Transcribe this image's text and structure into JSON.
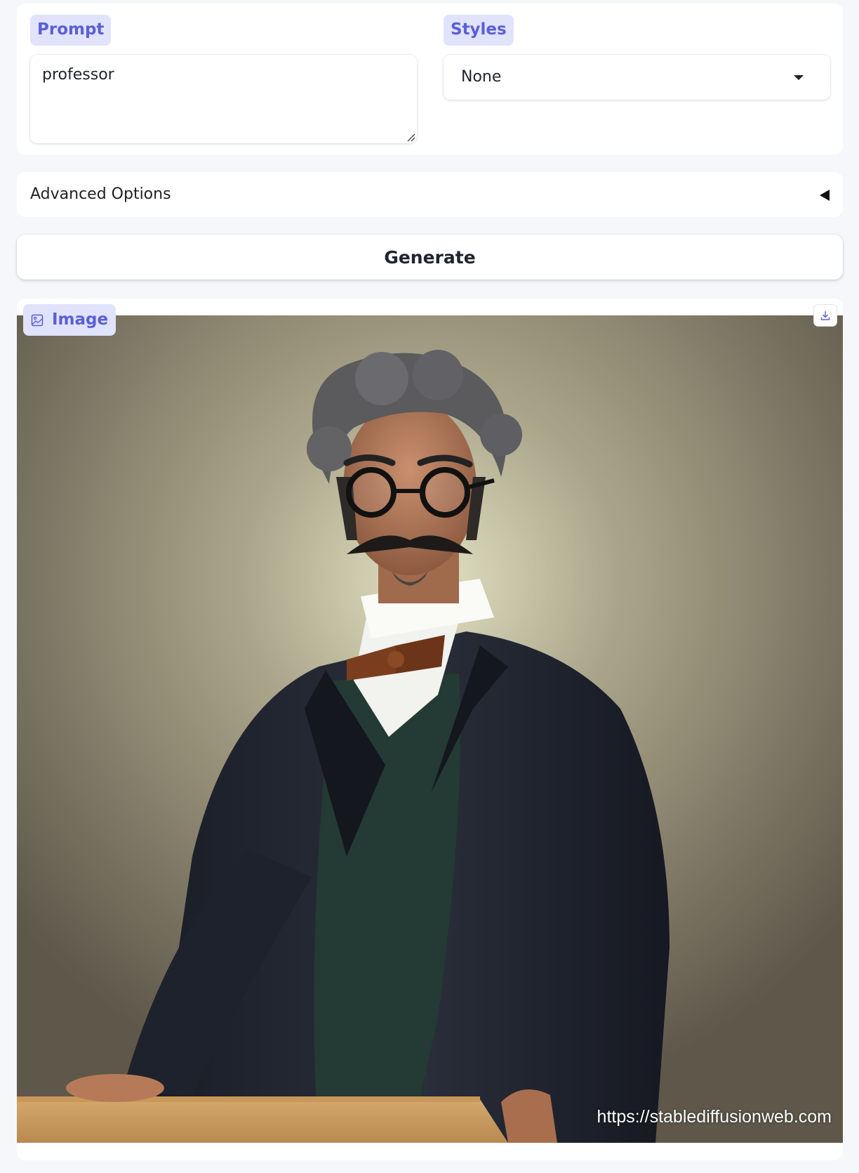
{
  "prompt": {
    "label": "Prompt",
    "value": "professor"
  },
  "styles": {
    "label": "Styles",
    "selected": "None"
  },
  "advanced_options": {
    "label": "Advanced Options",
    "collapsed": true
  },
  "generate": {
    "label": "Generate"
  },
  "image_output": {
    "label": "Image",
    "watermark": "https://stablediffusionweb.com",
    "description": "portrait painting of a professor with glasses, mustache and bow tie"
  },
  "colors": {
    "accent": "#5a5fd6",
    "label_bg": "#e0e3fb",
    "page_bg": "#f6f7fb"
  }
}
